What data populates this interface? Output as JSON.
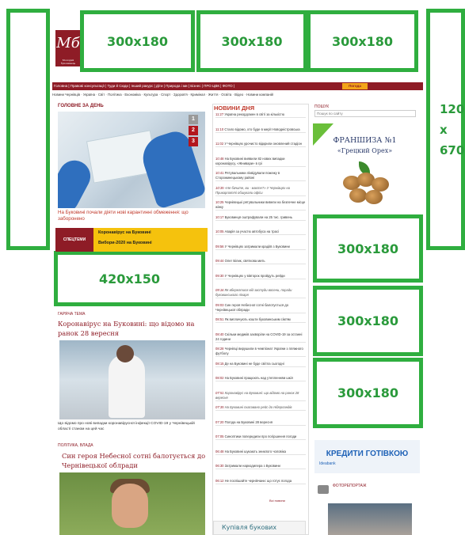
{
  "site": {
    "logo_text": "Мб",
    "logo_sub": "Молодий буковинець"
  },
  "nav": {
    "items": "Головна | Правові консультації | Туди й Сюди | Інший ракурс | Діти | Природа і ми | Бізнес | ПРО ЦВК | ФОТО |",
    "weather": "Погода",
    "sub_items": "Новини Чернівців · Україна · Світ · Політика · Економіка · Культура · Спорт · Здоров'я · Кримінал · Життя · Освіта · Відео · Новини компаній"
  },
  "ads": {
    "top1": "300x180",
    "top2": "300x180",
    "top3": "300x180",
    "side_right_line1": "120",
    "side_right_line2": "x",
    "side_right_line3": "670",
    "left_banner": "420x150",
    "r1": "300x180",
    "r2": "300x180",
    "r3": "300x180"
  },
  "main_news": {
    "section": "ГОЛОВНЕ ЗА ДЕНЬ",
    "caption": "На Буковині почали діяти нові карантинні обмеження: що заборонено",
    "pager": [
      "1",
      "2",
      "3"
    ]
  },
  "special": {
    "tag": "СПЕЦТЕМИ",
    "items": [
      "Коронавірус на Буковині",
      "Вибори-2020 на Буковині"
    ]
  },
  "hot": {
    "section": "ГАРЯЧА ТЕМА",
    "headline": "Коронавірус на Буковині: що відомо на ранок 28 вересня",
    "caption": "Що відомо про нові випадки коронавірусної інфекції COVID-19 у Чернівецькій області станом на цей час"
  },
  "politics": {
    "section": "ПОЛІТИКА, ВЛАДА",
    "headline": "Син героя Небесної сотні балотується до Чернівецької облради"
  },
  "news_feed": {
    "title": "НОВИНИ ДНЯ",
    "items": [
      {
        "time": "11:27",
        "text": "Україна рекордсмен в світі за кількістю",
        "italic": false
      },
      {
        "time": "11:10",
        "text": "Стало відомо, хто буде в мерії Новодністровська",
        "italic": false
      },
      {
        "time": "11:02",
        "text": "У Чернівцях урочисто відкрили оновлений стадіон",
        "italic": false
      },
      {
        "time": "10:48",
        "text": "На Буковині виявили 82 нових випадки коронавірусу, «Жнивари» в грі",
        "italic": false
      },
      {
        "time": "10:41",
        "text": "Рятувальники ліквідували пожежу в Сторожинецькому районі",
        "italic": false
      },
      {
        "time": "10:35",
        "text": "«Не бачите, ви - маєте?» У Чернівцях на Прикарпатті обшукали офіси",
        "italic": true
      },
      {
        "time": "10:25",
        "text": "Чернівецькі рятувальники вивели на безпечне місце жінку",
        "italic": false
      },
      {
        "time": "10:17",
        "text": "Буковинця оштрафували на 25 тис. гривень",
        "italic": false
      },
      {
        "time": "10:05",
        "text": "Аварія за участю автобуса на трасі",
        "italic": false
      },
      {
        "time": "09:56",
        "text": "У Чернівцях затримали крадіїв з Буковини",
        "italic": false
      },
      {
        "time": "09:44",
        "text": "Олег Білик, святкова мить",
        "italic": false
      },
      {
        "time": "09:30",
        "text": "У Чернівцях у вівторок пройдуть рейди",
        "italic": false
      },
      {
        "time": "09:16",
        "text": "Як вберегтися від застуди восени, поради буковинського лікаря",
        "italic": true
      },
      {
        "time": "09:03",
        "text": "Син героя Небесної сотні балотується до Чернівецької облради",
        "italic": false
      },
      {
        "time": "08:51",
        "text": "Як виплачують кошти буковинським сім'ям",
        "italic": false
      },
      {
        "time": "08:40",
        "text": "Скільки медиків захворіли на COVID-19 за останні 24 години",
        "italic": false
      },
      {
        "time": "08:28",
        "text": "Чернівці вирушили в чемпіонат України з пляжного футболу",
        "italic": false
      },
      {
        "time": "08:15",
        "text": "Де на Буковині не буде світла сьогодні",
        "italic": false
      },
      {
        "time": "08:02",
        "text": "На Буковині працюють над утепленням шкіл",
        "italic": false
      },
      {
        "time": "07:51",
        "text": "Коронавірус на Буковині: що відомо на ранок 28 вересня",
        "italic": true
      },
      {
        "time": "07:35",
        "text": "На Буковині скасовано рейс до Нідерландів",
        "italic": true
      },
      {
        "time": "07:20",
        "text": "Погода на Буковині 28 вересня",
        "italic": false
      },
      {
        "time": "07:05",
        "text": "Синоптики попередили про погіршення погоди",
        "italic": false
      },
      {
        "time": "06:48",
        "text": "На Буковині шукають зниклого чоловіка",
        "italic": false
      },
      {
        "time": "06:30",
        "text": "Затримали наркодилера з Буковини",
        "italic": false
      },
      {
        "time": "06:12",
        "text": "Не поспішайте чернівчани: що готує погода",
        "italic": false
      }
    ],
    "all_link": "Всі новини"
  },
  "search": {
    "label": "ПОШУК",
    "placeholder": "Пошук по сайту"
  },
  "franchise": {
    "line1": "ФРАНШИЗА №1",
    "line2": "«Грецкий Орех»"
  },
  "credit": {
    "text": "КРЕДИТИ ГОТІВКОЮ",
    "bank": "Ideabank"
  },
  "photo": {
    "section": "ФОТОРЕПОРТАЖ"
  },
  "bottom_ad": {
    "text": "Купівля букових"
  },
  "colors": {
    "ad_border": "#2fae3f",
    "brand": "#8e1c26",
    "special_bg": "#f5c20d"
  }
}
